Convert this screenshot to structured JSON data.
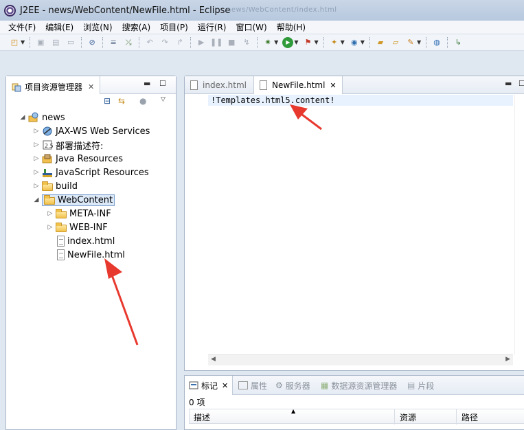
{
  "window": {
    "title": "J2EE  -  news/WebContent/NewFile.html  -  Eclipse",
    "ghost_text": "news/WebContent/index.html"
  },
  "menu": [
    "文件(F)",
    "编辑(E)",
    "浏览(N)",
    "搜索(A)",
    "项目(P)",
    "运行(R)",
    "窗口(W)",
    "帮助(H)"
  ],
  "explorer": {
    "tab_label": "项目资源管理器",
    "tree": [
      {
        "label": "news"
      },
      {
        "label": "JAX-WS Web Services"
      },
      {
        "label": "部署描述符:"
      },
      {
        "label": "Java Resources"
      },
      {
        "label": "JavaScript Resources"
      },
      {
        "label": "build"
      },
      {
        "label": "WebContent"
      },
      {
        "label": "META-INF"
      },
      {
        "label": "WEB-INF"
      },
      {
        "label": "index.html"
      },
      {
        "label": "NewFile.html"
      }
    ]
  },
  "editor": {
    "tabs": [
      {
        "label": "index.html"
      },
      {
        "label": "NewFile.html"
      }
    ],
    "code": "!Templates.html5.content!"
  },
  "bottom": {
    "tabs": [
      "标记",
      "属性",
      "服务器",
      "数据源资源管理器",
      "片段"
    ],
    "count": "0 项",
    "columns": [
      "描述",
      "资源",
      "路径"
    ]
  },
  "colors": {
    "arrow": "#e8392f",
    "selection": "#dbe8f7",
    "current_line": "#e8f2fe"
  }
}
